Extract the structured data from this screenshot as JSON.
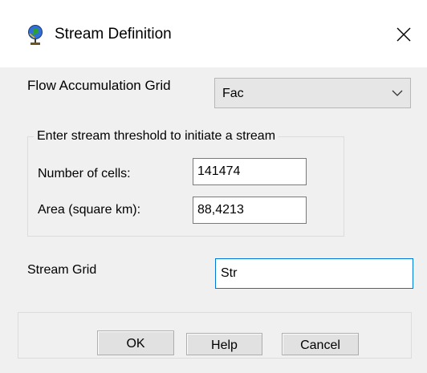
{
  "window": {
    "title": "Stream Definition",
    "icon": "globe-icon",
    "close_icon": "close-icon"
  },
  "flow_accumulation": {
    "label": "Flow Accumulation Grid",
    "selected": "Fac",
    "dropdown_icon": "chevron-down-icon"
  },
  "threshold_group": {
    "title": "Enter stream threshold to initiate a stream",
    "cells_label": "Number of cells:",
    "cells_value": "141474",
    "area_label": "Area (square km):",
    "area_value": "88,4213"
  },
  "stream_grid": {
    "label": "Stream Grid",
    "value": "Str"
  },
  "buttons": {
    "ok": "OK",
    "help": "Help",
    "cancel": "Cancel"
  },
  "colors": {
    "dialog_bg": "#f0f0f0",
    "focus_border": "#0078d7"
  }
}
